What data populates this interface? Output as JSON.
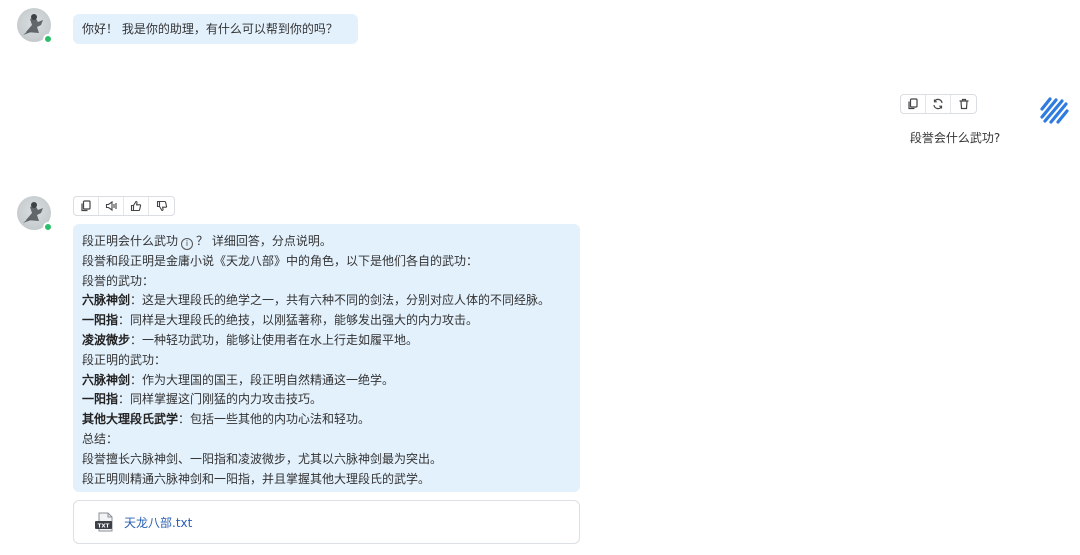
{
  "assistant_greeting": {
    "text": "你好！ 我是你的助理，有什么可以帮到你的吗？"
  },
  "user_message": {
    "text": "段誉会什么武功?",
    "actions": [
      "copy-icon",
      "refresh-icon",
      "delete-icon"
    ]
  },
  "assistant_answer": {
    "actions": [
      "copy-icon",
      "speaker-icon",
      "thumbs-up-icon",
      "thumbs-down-icon"
    ],
    "lines": [
      {
        "bold": "",
        "pre": "段正明会什么武功",
        "post": "？ 详细回答，分点说明。",
        "has_info_icon": true
      },
      {
        "bold": "",
        "text": "段誉和段正明是金庸小说《天龙八部》中的角色，以下是他们各自的武功："
      },
      {
        "bold": "",
        "text": "段誉的武功："
      },
      {
        "bold": "六脉神剑",
        "text": "：这是大理段氏的绝学之一，共有六种不同的剑法，分别对应人体的不同经脉。"
      },
      {
        "bold": "一阳指",
        "text": "：同样是大理段氏的绝技，以刚猛著称，能够发出强大的内力攻击。"
      },
      {
        "bold": "凌波微步",
        "text": "：一种轻功武功，能够让使用者在水上行走如履平地。"
      },
      {
        "bold": "",
        "text": "段正明的武功："
      },
      {
        "bold": "六脉神剑",
        "text": "：作为大理国的国王，段正明自然精通这一绝学。"
      },
      {
        "bold": "一阳指",
        "text": "：同样掌握这门刚猛的内力攻击技巧。"
      },
      {
        "bold": "其他大理段氏武学",
        "text": "：包括一些其他的内功心法和轻功。"
      },
      {
        "bold": "",
        "text": "总结："
      },
      {
        "bold": "",
        "text": "段誉擅长六脉神剑、一阳指和凌波微步，尤其以六脉神剑最为突出。"
      },
      {
        "bold": "",
        "text": "段正明则精通六脉神剑和一阳指，并且掌握其他大理段氏的武学。"
      }
    ],
    "attachment": {
      "icon_label": "TXT",
      "filename": "天龙八部.txt"
    }
  },
  "colors": {
    "bubble_bg": "#e3f1fd",
    "online_dot": "#2bbf6a",
    "file_link": "#2a5fb3",
    "brand_logo": "#2f7be0"
  }
}
